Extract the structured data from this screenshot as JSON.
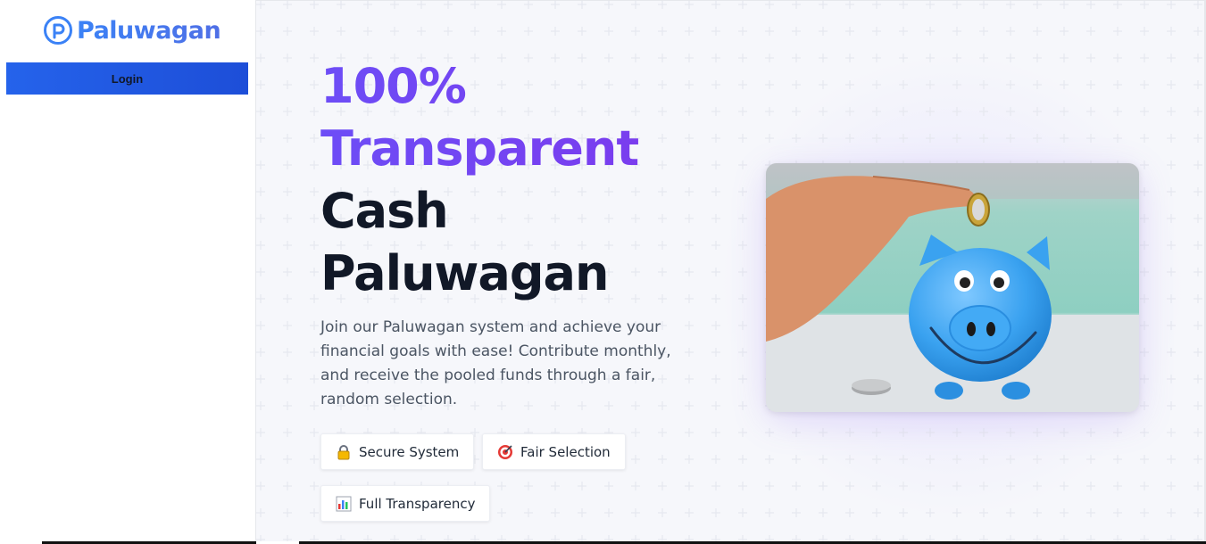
{
  "sidebar": {
    "brand": "Paluwagan",
    "login_label": "Login"
  },
  "hero": {
    "title_line1": "100%",
    "title_line2": "Transparent",
    "title_line3": "Cash",
    "title_line4": "Paluwagan",
    "description": "Join our Paluwagan system and achieve your financial goals with ease! Contribute monthly, and receive the pooled funds through a fair, random selection.",
    "features": [
      {
        "icon": "lock-icon",
        "label": "Secure System"
      },
      {
        "icon": "target-icon",
        "label": "Fair Selection"
      },
      {
        "icon": "bar-chart-icon",
        "label": "Full Transparency"
      }
    ],
    "image_icon": "piggy-bank-photo"
  },
  "colors": {
    "brand_blue": "#3b82f6",
    "button_blue": "#2563eb",
    "accent_purple": "#6d4df6",
    "text_dark": "#111827",
    "text_muted": "#4b5563",
    "background": "#f6f7fb"
  }
}
